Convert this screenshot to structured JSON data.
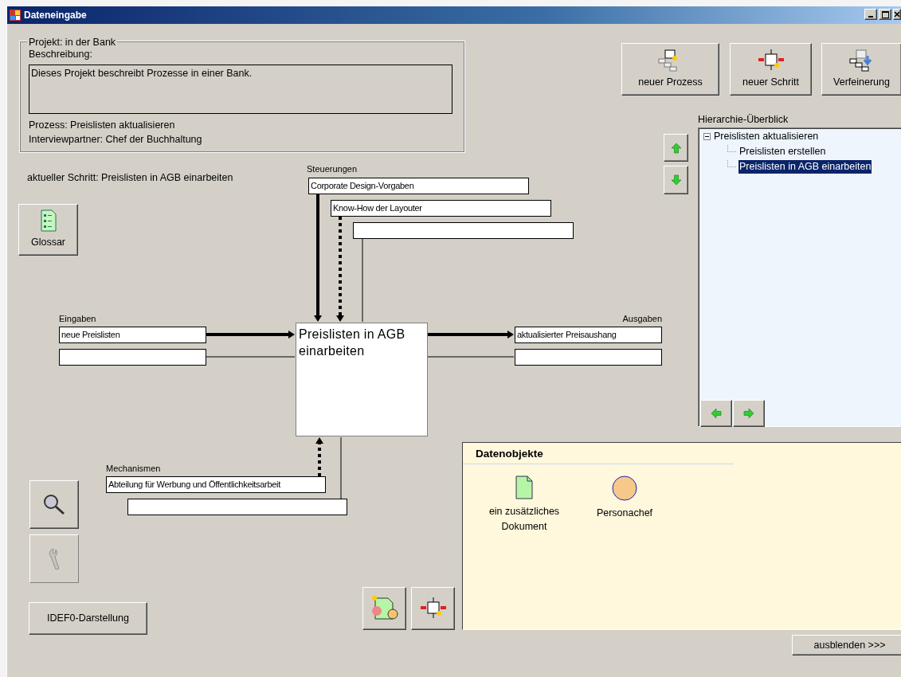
{
  "window": {
    "title": "Dateneingabe"
  },
  "project": {
    "legend": "Projekt: in der Bank",
    "description_label": "Beschreibung:",
    "description": "Dieses Projekt beschreibt Prozesse in einer Bank.",
    "process": "Prozess: Preislisten aktualisieren",
    "interview": "Interviewpartner: Chef der Buchhaltung"
  },
  "toolbar": [
    {
      "label": "neuer Prozess",
      "kind": "process"
    },
    {
      "label": "neuer Schritt",
      "kind": "step"
    },
    {
      "label": "Verfeinerung",
      "kind": "refine"
    }
  ],
  "hierarchy": {
    "label": "Hierarchie-Überblick",
    "tree": [
      {
        "label": "Preislisten aktualisieren",
        "expanded": true,
        "selected": false,
        "children": [
          {
            "label": "Preislisten erstellen",
            "selected": false
          },
          {
            "label": "Preislisten in AGB einarbeiten",
            "selected": true
          }
        ]
      }
    ]
  },
  "current_step": "aktueller Schritt: Preislisten in AGB einarbeiten",
  "glossary_button": "Glossar",
  "diagram": {
    "activity": "Preislisten in AGB einarbeiten",
    "controls_label": "Steuerungen",
    "controls": [
      {
        "text": "Corporate Design-Vorgaben",
        "kind": "solid"
      },
      {
        "text": "Know-How der Layouter",
        "kind": "dotted"
      },
      {
        "kind": "line"
      }
    ],
    "inputs_label": "Eingaben",
    "inputs": [
      {
        "text": "neue Preislisten",
        "kind": "solid"
      },
      {
        "kind": "line"
      }
    ],
    "outputs_label": "Ausgaben",
    "outputs": [
      {
        "text": "aktualisierter Preisaushang",
        "kind": "solid"
      },
      {
        "kind": "line"
      }
    ],
    "mechanisms_label": "Mechanismen",
    "mechanisms": [
      {
        "text": "Abteilung für Werbung und Öffentlichkeitsarbeit",
        "kind": "dotted"
      },
      {
        "kind": "line"
      }
    ]
  },
  "tools": [
    {
      "kind": "zoom",
      "disabled": false
    },
    {
      "kind": "wrench",
      "disabled": true
    }
  ],
  "idef0_button": "IDEF0-Darstellung",
  "data_objects": {
    "title": "Datenobjekte",
    "items": [
      {
        "label": "ein zusätzliches Dokument",
        "kind": "document"
      },
      {
        "label": "Personachef",
        "kind": "person"
      }
    ]
  },
  "hide_button": "ausblenden >>>"
}
